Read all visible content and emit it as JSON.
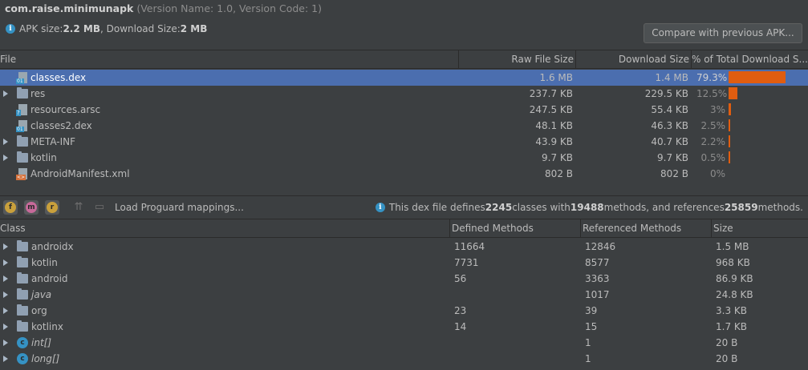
{
  "header": {
    "package": "com.raise.minimunapk",
    "version_info": "(Version Name: 1.0, Version Code: 1)",
    "apk_size_label": "APK size: ",
    "apk_size": "2.2 MB",
    "download_size_label": ", Download Size: ",
    "download_size": "2 MB",
    "compare_button": "Compare with previous APK..."
  },
  "file_table": {
    "columns": [
      "File",
      "Raw File Size",
      "Download Size",
      "% of Total Download S..."
    ],
    "rows": [
      {
        "name": "classes.dex",
        "raw": "1.6 MB",
        "download": "1.4 MB",
        "percent": "79.3%",
        "pct_value": 79.3,
        "type": "dex",
        "expandable": false,
        "selected": true
      },
      {
        "name": "res",
        "raw": "237.7 KB",
        "download": "229.5 KB",
        "percent": "12.5%",
        "pct_value": 12.5,
        "type": "folder",
        "expandable": true,
        "selected": false
      },
      {
        "name": "resources.arsc",
        "raw": "247.5 KB",
        "download": "55.4 KB",
        "percent": "3%",
        "pct_value": 3.0,
        "type": "arsc",
        "expandable": false,
        "selected": false
      },
      {
        "name": "classes2.dex",
        "raw": "48.1 KB",
        "download": "46.3 KB",
        "percent": "2.5%",
        "pct_value": 2.5,
        "type": "dex",
        "expandable": false,
        "selected": false
      },
      {
        "name": "META-INF",
        "raw": "43.9 KB",
        "download": "40.7 KB",
        "percent": "2.2%",
        "pct_value": 2.2,
        "type": "folder",
        "expandable": true,
        "selected": false
      },
      {
        "name": "kotlin",
        "raw": "9.7 KB",
        "download": "9.7 KB",
        "percent": "0.5%",
        "pct_value": 0.5,
        "type": "folder",
        "expandable": true,
        "selected": false
      },
      {
        "name": "AndroidManifest.xml",
        "raw": "802 B",
        "download": "802 B",
        "percent": "0%",
        "pct_value": 0,
        "type": "xml",
        "expandable": false,
        "selected": false
      }
    ]
  },
  "toolbar": {
    "btn_f": "f",
    "btn_m": "m",
    "btn_r": "r",
    "load_mappings": "Load Proguard mappings...",
    "dex_info_prefix": "This dex file defines ",
    "classes_count": "2245",
    "classes_with": " classes with ",
    "methods_count": "19488",
    "methods_refs": " methods, and references ",
    "references_count": "25859",
    "methods_suffix": " methods."
  },
  "class_table": {
    "columns": [
      "Class",
      "Defined Methods",
      "Referenced Methods",
      "Size"
    ],
    "rows": [
      {
        "name": "androidx",
        "defined": "11664",
        "referenced": "12846",
        "size": "1.5 MB",
        "type": "package",
        "italic": false
      },
      {
        "name": "kotlin",
        "defined": "7731",
        "referenced": "8577",
        "size": "968 KB",
        "type": "package",
        "italic": false
      },
      {
        "name": "android",
        "defined": "56",
        "referenced": "3363",
        "size": "86.9 KB",
        "type": "package",
        "italic": false
      },
      {
        "name": "java",
        "defined": "",
        "referenced": "1017",
        "size": "24.8 KB",
        "type": "package",
        "italic": true
      },
      {
        "name": "org",
        "defined": "23",
        "referenced": "39",
        "size": "3.3 KB",
        "type": "package",
        "italic": false
      },
      {
        "name": "kotlinx",
        "defined": "14",
        "referenced": "15",
        "size": "1.7 KB",
        "type": "package",
        "italic": false
      },
      {
        "name": "int[]",
        "defined": "",
        "referenced": "1",
        "size": "20 B",
        "type": "class",
        "italic": true
      },
      {
        "name": "long[]",
        "defined": "",
        "referenced": "1",
        "size": "20 B",
        "type": "class",
        "italic": true
      }
    ]
  },
  "colors": {
    "background": "#3c3f41",
    "selected_row": "#4b6eaf",
    "bar": "#e05d10",
    "info_blue": "#3592c4"
  }
}
